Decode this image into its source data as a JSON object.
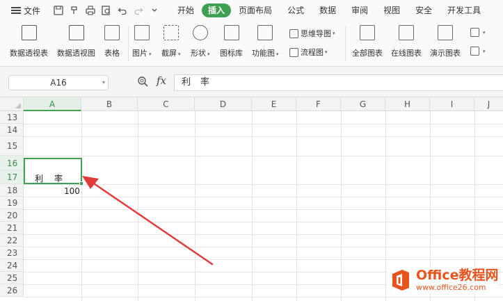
{
  "menubar": {
    "file_label": "文件",
    "tabs": [
      {
        "label": "开始"
      },
      {
        "label": "插入"
      },
      {
        "label": "页面布局"
      },
      {
        "label": "公式"
      },
      {
        "label": "数据"
      },
      {
        "label": "审阅"
      },
      {
        "label": "视图"
      },
      {
        "label": "安全"
      },
      {
        "label": "开发工具"
      }
    ],
    "active_tab": "插入",
    "accent_color": "#3fa050"
  },
  "ribbon": {
    "items": [
      {
        "label": "数据透视表",
        "icon": "pivot-table-icon"
      },
      {
        "label": "数据透视图",
        "icon": "pivot-chart-icon"
      },
      {
        "label": "表格",
        "icon": "table-icon"
      },
      {
        "label": "图片",
        "icon": "picture-icon"
      },
      {
        "label": "截屏",
        "icon": "screenshot-icon"
      },
      {
        "label": "形状",
        "icon": "shapes-icon"
      },
      {
        "label": "图标库",
        "icon": "icon-library-icon"
      },
      {
        "label": "功能图",
        "icon": "function-chart-icon"
      },
      {
        "label": "全部图表",
        "icon": "all-charts-icon"
      },
      {
        "label": "在线图表",
        "icon": "online-chart-icon"
      },
      {
        "label": "演示图表",
        "icon": "demo-chart-icon"
      }
    ],
    "mindmap_label": "思维导图",
    "flowchart_label": "流程图"
  },
  "formula_bar": {
    "name_box": "A16",
    "fx": "fx",
    "content": "利率"
  },
  "grid": {
    "columns": [
      "A",
      "B",
      "C",
      "D",
      "E",
      "F",
      "G",
      "H",
      "I",
      "J"
    ],
    "rows": [
      "13",
      "14",
      "15",
      "16",
      "17",
      "18",
      "19",
      "20",
      "21",
      "22",
      "23",
      "24",
      "25",
      "26"
    ],
    "selected_column": "A",
    "selected_rows": [
      "16",
      "17"
    ],
    "cells": {
      "A16": "利　率",
      "A18": "100"
    }
  },
  "watermark": {
    "title": "Office教程网",
    "url": "www.office26.com",
    "color": "#e8541e"
  }
}
